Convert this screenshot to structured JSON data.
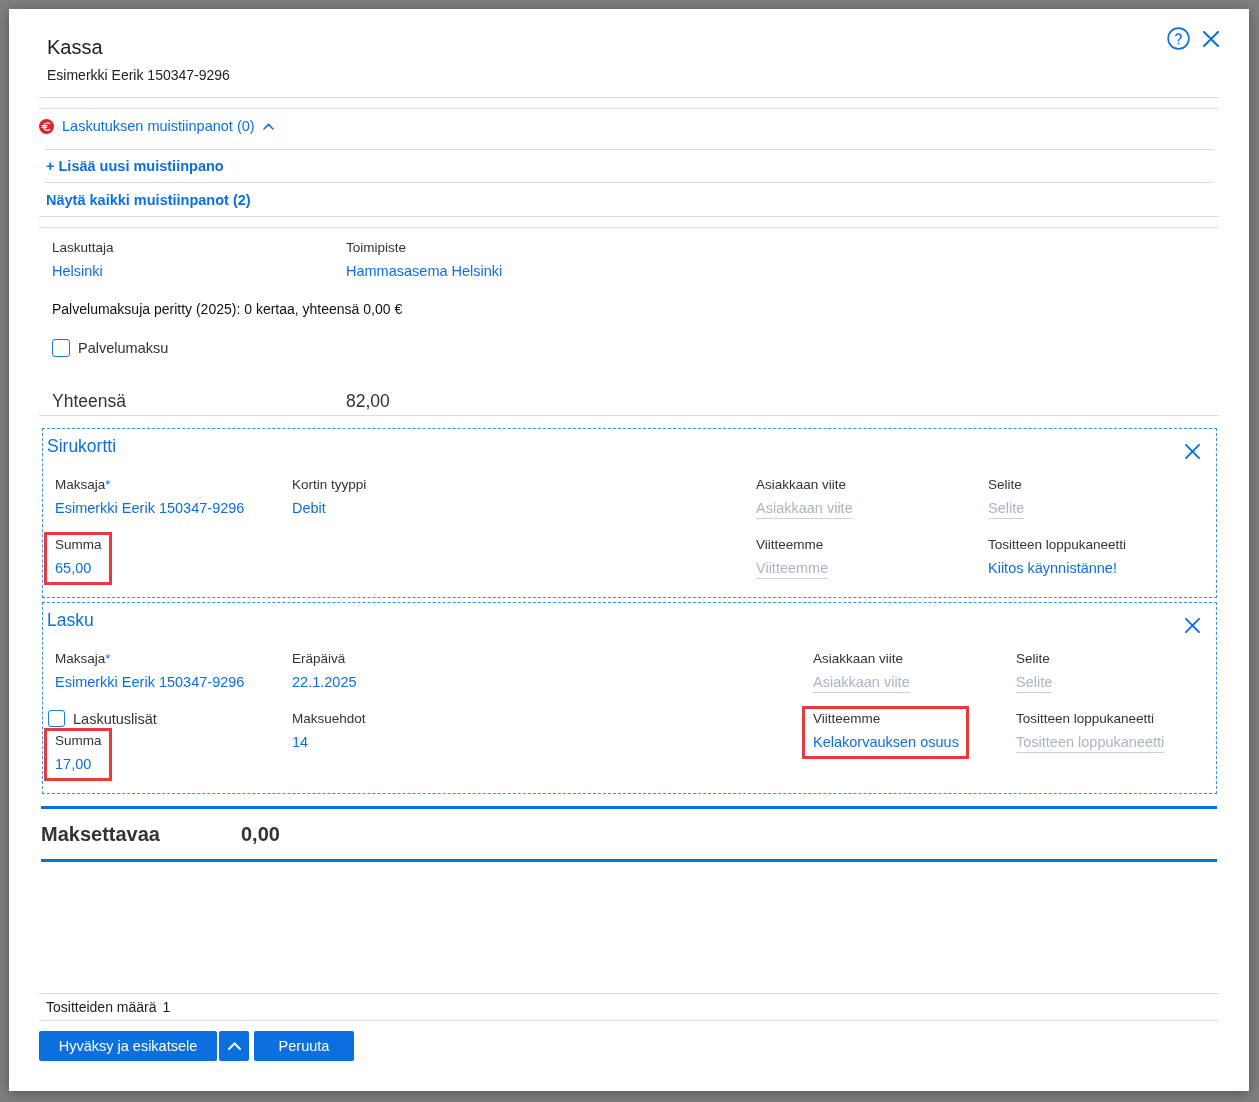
{
  "dialog": {
    "title": "Kassa",
    "subtitle": "Esimerkki Eerik 150347-9296"
  },
  "notes": {
    "label": "Laskutuksen muistiinpanot (0)",
    "expanded": true,
    "links": [
      "+ Lisää uusi muistiinpano",
      "Näytä kaikki muistiinpanot (2)"
    ]
  },
  "billing": [
    {
      "label": "Laskuttaja",
      "value": "Helsinki"
    },
    {
      "label": "Toimipiste",
      "value": "Hammasasema Helsinki"
    }
  ],
  "service_fee_info": "Palvelumaksuja peritty (2025): 0 kertaa, yhteensä 0,00 €",
  "service_fee": {
    "label": "Palvelumaksu",
    "checked": false
  },
  "total": {
    "label": "Yhteensä",
    "value": "82,00"
  },
  "payments": [
    {
      "title": "Sirukortti",
      "kind": "card",
      "rows": [
        {
          "left": [
            [
              {
                "kind": "field",
                "label": "Maksaja",
                "required_mark": "*",
                "value": "Esimerkki Eerik 150347-9296",
                "highlighted": false
              }
            ],
            [
              {
                "kind": "field",
                "label": "Kortin tyyppi",
                "value": "Debit",
                "highlighted": false
              }
            ]
          ],
          "right": [
            [
              {
                "kind": "field",
                "label": "Asiakkaan viite",
                "placeholder": "Asiakkaan viite",
                "highlighted": false
              }
            ],
            [
              {
                "kind": "field",
                "label": "Selite",
                "placeholder": "Selite",
                "highlighted": false
              }
            ]
          ]
        },
        {
          "left": [
            [
              {
                "kind": "field",
                "label": "Summa",
                "value": "65,00",
                "highlighted": true
              }
            ]
          ],
          "right": [
            [
              {
                "kind": "field",
                "label": "Viitteemme",
                "placeholder": "Viitteemme",
                "highlighted": false
              }
            ],
            [
              {
                "kind": "field",
                "label": "Tositteen loppukaneetti",
                "value": "Kiitos käynnistänne!",
                "highlighted": false
              }
            ]
          ]
        }
      ]
    },
    {
      "title": "Lasku",
      "kind": "invoice",
      "rows": [
        {
          "left": [
            [
              {
                "kind": "field",
                "label": "Maksaja",
                "required_mark": "*",
                "value": "Esimerkki Eerik 150347-9296",
                "highlighted": false
              }
            ],
            [
              {
                "kind": "field",
                "label": "Eräpäivä",
                "value": "22.1.2025",
                "highlighted": false
              }
            ]
          ],
          "right": [
            [
              {
                "kind": "field",
                "label": "Asiakkaan viite",
                "placeholder": "Asiakkaan viite",
                "highlighted": false
              }
            ],
            [
              {
                "kind": "field",
                "label": "Selite",
                "placeholder": "Selite",
                "highlighted": false
              }
            ]
          ]
        },
        {
          "left": [
            [
              {
                "kind": "checkbox",
                "label": "Laskutuslisät",
                "checked": false
              },
              {
                "kind": "field",
                "label": "Summa",
                "value": "17,00",
                "highlighted": true
              }
            ],
            [
              {
                "kind": "field",
                "label": "Maksuehdot",
                "value": "14",
                "highlighted": false
              }
            ]
          ],
          "right": [
            [
              {
                "kind": "field",
                "label": "Viitteemme",
                "value": "Kelakorvauksen osuus",
                "highlighted": true
              }
            ],
            [
              {
                "kind": "field",
                "label": "Tositteen loppukaneetti",
                "placeholder": "Tositteen loppukaneetti",
                "highlighted": false
              }
            ]
          ]
        }
      ]
    }
  ],
  "amount_due": {
    "label": "Maksettavaa",
    "value": "0,00"
  },
  "footer": {
    "label": "Tositteiden määrä",
    "value": "1"
  },
  "buttons": [
    {
      "kind": "primary",
      "label": "Hyväksy ja esikatsele"
    },
    {
      "kind": "menu"
    },
    {
      "kind": "primary",
      "label": "Peruuta"
    }
  ]
}
